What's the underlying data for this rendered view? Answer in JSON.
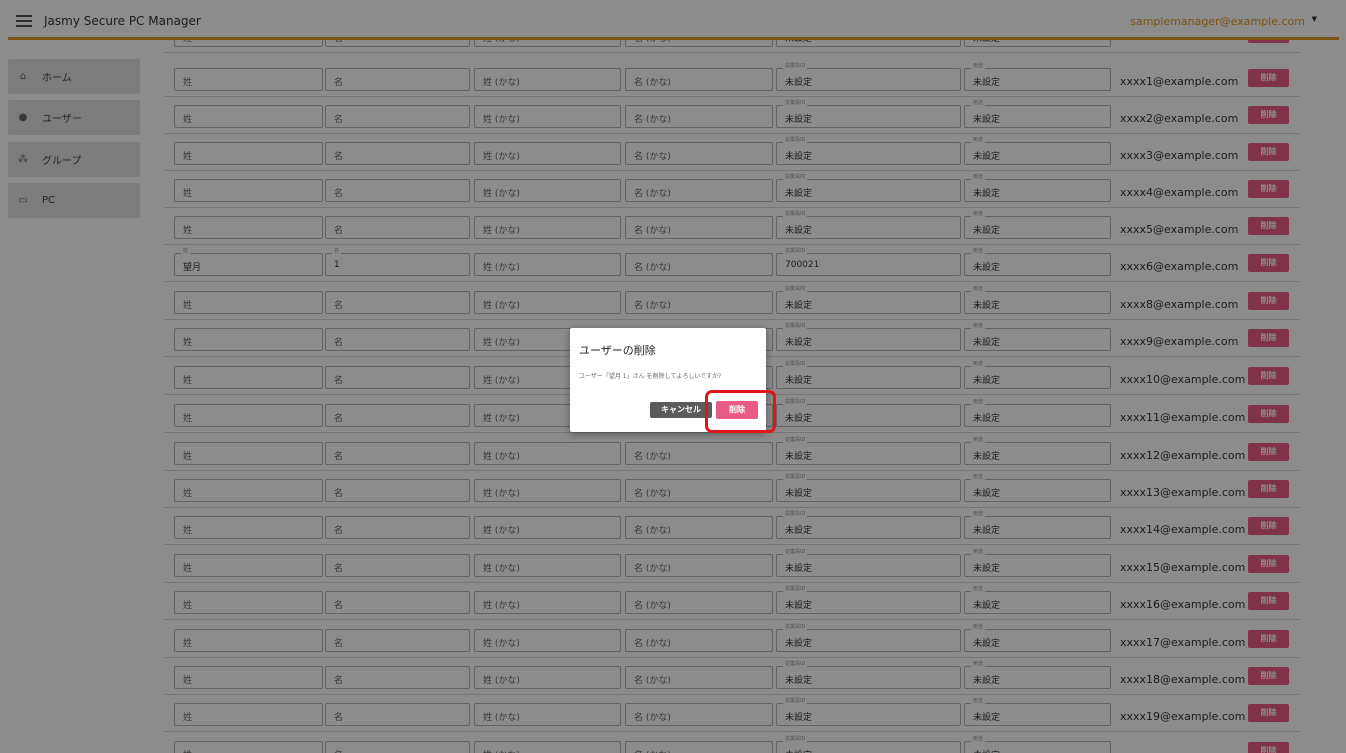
{
  "app": {
    "title": "Jasmy Secure PC Manager",
    "user_email": "samplemanager@example.com"
  },
  "nav": [
    {
      "icon": "home-icon",
      "glyph": "⌂",
      "label": "ホーム"
    },
    {
      "icon": "user-icon",
      "glyph": "●",
      "label": "ユーザー"
    },
    {
      "icon": "group-icon",
      "glyph": "⁂",
      "label": "グループ"
    },
    {
      "icon": "pc-icon",
      "glyph": "▭",
      "label": "PC"
    }
  ],
  "field_labels": {
    "employee_id": "従業員ID",
    "usage": "用途",
    "last_name": "姓",
    "first_name": "名"
  },
  "placeholders": {
    "last_name": "姓",
    "first_name": "名",
    "last_kana": "姓 (かな)",
    "first_kana": "名 (かな)"
  },
  "unset": "未設定",
  "delete_label": "削除",
  "users": [
    {
      "last_name": "",
      "first_name": "",
      "employee_id": "",
      "email": ""
    },
    {
      "last_name": "",
      "first_name": "",
      "employee_id": "",
      "email": "xxxx1@example.com"
    },
    {
      "last_name": "",
      "first_name": "",
      "employee_id": "",
      "email": "xxxx2@example.com"
    },
    {
      "last_name": "",
      "first_name": "",
      "employee_id": "",
      "email": "xxxx3@example.com"
    },
    {
      "last_name": "",
      "first_name": "",
      "employee_id": "",
      "email": "xxxx4@example.com"
    },
    {
      "last_name": "",
      "first_name": "",
      "employee_id": "",
      "email": "xxxx5@example.com"
    },
    {
      "last_name": "望月",
      "first_name": "1",
      "employee_id": "700021",
      "email": "xxxx6@example.com"
    },
    {
      "last_name": "",
      "first_name": "",
      "employee_id": "",
      "email": "xxxx8@example.com"
    },
    {
      "last_name": "",
      "first_name": "",
      "employee_id": "",
      "email": "xxxx9@example.com"
    },
    {
      "last_name": "",
      "first_name": "",
      "employee_id": "",
      "email": "xxxx10@example.com"
    },
    {
      "last_name": "",
      "first_name": "",
      "employee_id": "",
      "email": "xxxx11@example.com"
    },
    {
      "last_name": "",
      "first_name": "",
      "employee_id": "",
      "email": "xxxx12@example.com"
    },
    {
      "last_name": "",
      "first_name": "",
      "employee_id": "",
      "email": "xxxx13@example.com"
    },
    {
      "last_name": "",
      "first_name": "",
      "employee_id": "",
      "email": "xxxx14@example.com"
    },
    {
      "last_name": "",
      "first_name": "",
      "employee_id": "",
      "email": "xxxx15@example.com"
    },
    {
      "last_name": "",
      "first_name": "",
      "employee_id": "",
      "email": "xxxx16@example.com"
    },
    {
      "last_name": "",
      "first_name": "",
      "employee_id": "",
      "email": "xxxx17@example.com"
    },
    {
      "last_name": "",
      "first_name": "",
      "employee_id": "",
      "email": "xxxx18@example.com"
    },
    {
      "last_name": "",
      "first_name": "",
      "employee_id": "",
      "email": "xxxx19@example.com"
    },
    {
      "last_name": "",
      "first_name": "",
      "employee_id": "",
      "email": ""
    }
  ],
  "dialog": {
    "title": "ユーザーの削除",
    "message": "ユーザー「望月 1」さん を削除してよろしいですか?",
    "cancel_label": "キャンセル",
    "delete_label": "削除"
  },
  "colors": {
    "accent": "#e39a1f",
    "danger": "#e95b84",
    "cancel": "#5b5b5b",
    "highlight": "#e0141b"
  }
}
